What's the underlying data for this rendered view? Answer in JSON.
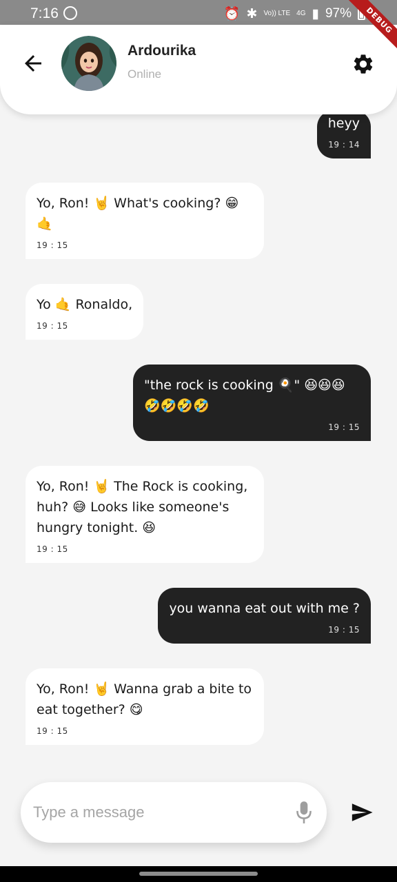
{
  "status_bar": {
    "time": "7:16",
    "battery": "97%",
    "network": "4G",
    "volte": "Vo)) LTE",
    "icons": [
      "whatsapp-icon",
      "alarm-icon",
      "bluetooth-icon",
      "signal-icon",
      "battery-icon"
    ]
  },
  "debug_banner": "DEBUG",
  "header": {
    "contact_name": "Ardourika",
    "presence": "Online",
    "icons": [
      "back-arrow-icon",
      "avatar",
      "gear-icon"
    ]
  },
  "messages": [
    {
      "direction": "outgoing",
      "text": "heyy",
      "time": "19 : 14"
    },
    {
      "direction": "incoming",
      "text": "Yo, Ron! 🤘 What's  cooking? 😁 🤙",
      "time": "19 : 15"
    },
    {
      "direction": "incoming",
      "text": "Yo 🤙 Ronaldo,",
      "time": "19 : 15"
    },
    {
      "direction": "outgoing",
      "text": "\"the rock is cooking 🍳\" 😆😆😆 🤣🤣🤣🤣",
      "time": "19 : 15"
    },
    {
      "direction": "incoming",
      "text": "Yo, Ron! 🤘 The Rock is cooking, huh? 😅 Looks like someone's hungry tonight. 😆",
      "time": "19 : 15"
    },
    {
      "direction": "outgoing",
      "text": "you wanna eat out with me ?",
      "time": "19 : 15"
    },
    {
      "direction": "incoming",
      "text": "Yo, Ron! 🤘 Wanna grab a bite to eat together? 😋",
      "time": "19 : 15"
    }
  ],
  "composer": {
    "placeholder": "Type a message",
    "value": "",
    "icons": [
      "mic-icon",
      "send-icon"
    ]
  },
  "colors": {
    "background": "#f4f4f4",
    "outgoing_bubble": "#222222",
    "incoming_bubble": "#ffffff",
    "header": "#ffffff",
    "status_bar": "#8a8a8a"
  }
}
